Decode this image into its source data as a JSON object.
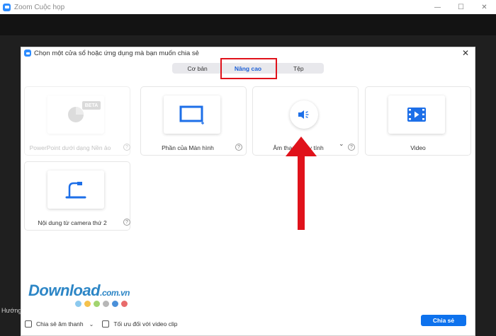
{
  "window": {
    "title": "Zoom Cuộc họp",
    "controls": {
      "minimize": "—",
      "maximize": "☐",
      "close": "✕"
    },
    "bottom_text": "Hướng"
  },
  "dialog": {
    "title": "Chọn một cửa sổ hoặc ứng dụng mà bạn muốn chia sẻ",
    "close_glyph": "✕",
    "tabs": [
      {
        "label": "Cơ bản"
      },
      {
        "label": "Nâng cao",
        "active": true
      },
      {
        "label": "Tệp"
      }
    ],
    "cards": [
      {
        "label": "PowerPoint dưới dạng Nền ảo",
        "badge": "BETA",
        "icon": "powerpoint-pie-icon",
        "disabled": true,
        "help": "?"
      },
      {
        "label": "Phần của Màn hình",
        "icon": "screen-portion-icon",
        "help": "?"
      },
      {
        "label": "Âm thanh máy tính",
        "icon": "speaker-icon",
        "has_dropdown": true,
        "dropdown_glyph": "⌄",
        "help": "?"
      },
      {
        "label": "Video",
        "icon": "film-icon"
      },
      {
        "label": "Nội dung từ camera thứ 2",
        "icon": "document-camera-icon",
        "help": "?"
      }
    ],
    "bottom": {
      "share_audio_label": "Chia sẻ âm thanh",
      "share_audio_caret": "⌄",
      "optimize_label": "Tối ưu đối với video clip",
      "share_button": "Chia sẻ"
    }
  },
  "watermark": {
    "text": "Download",
    "suffix": ".com.vn",
    "dot_colors": [
      "#8cc9ee",
      "#f5c24c",
      "#a2d46f",
      "#b7b7b7",
      "#4a90d9",
      "#e86b6b"
    ]
  },
  "colors": {
    "accent": "#0e72ed",
    "highlight_box": "#e0121b",
    "arrow": "#e0121b"
  }
}
